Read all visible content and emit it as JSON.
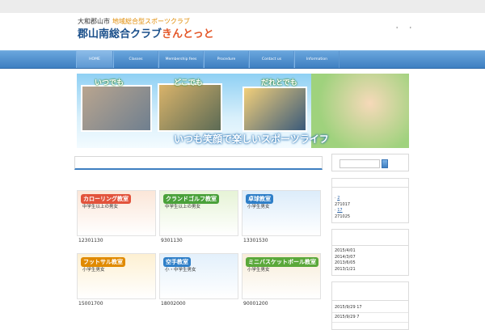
{
  "site": {
    "city": "大和郡山市",
    "tagline": "地域総合型スポーツクラブ",
    "name_main": "郡山南総合クラブ",
    "name_accent": "きんとっと",
    "header_dots": "' '"
  },
  "nav": {
    "items": [
      {
        "label": "HOME",
        "active": true
      },
      {
        "label": "Classes"
      },
      {
        "label": "Membership fees"
      },
      {
        "label": "Procedure"
      },
      {
        "label": "Contact us"
      },
      {
        "label": "Information"
      }
    ]
  },
  "banner": {
    "labels": [
      "いつでも",
      "どこでも",
      "だれとでも"
    ],
    "slogan": "いつも笑顔で楽しいスポーツライフ"
  },
  "classes": [
    {
      "title": "カローリング教室",
      "sub": "中学生以上の男女",
      "num": "12301130",
      "color": "#e2533c",
      "bg": "#fbe6d8"
    },
    {
      "title": "クランドゴルフ教室",
      "sub": "中学生以上の男女",
      "num": "9301130",
      "color": "#4aa13a",
      "bg": "#e6f3d6"
    },
    {
      "title": "卓球教室",
      "sub": "小学生男女",
      "num": "13301530",
      "color": "#2f7fc8",
      "bg": "#dcecfa"
    },
    {
      "title": "フットサル教室",
      "sub": "小学生男女",
      "num": "15001700",
      "color": "#e08a00",
      "bg": "#fdf0d2"
    },
    {
      "title": "空手教室",
      "sub": "小・中学生男女",
      "num": "18002000",
      "color": "#2f7fc8",
      "bg": "#e3f0fb"
    },
    {
      "title": "ミニバスケットボール教室",
      "sub": "小学生男女",
      "num": "90001200",
      "color": "#5aa83a",
      "bg": "#f7ecd8"
    }
  ],
  "sidebar": {
    "search_placeholder": "",
    "widget1": [
      {
        "prefix": "· ",
        "link": "2"
      },
      {
        "prefix": "",
        "text": "271017"
      },
      {
        "prefix": "· ",
        "link": "17"
      },
      {
        "prefix": "",
        "text": "271025"
      }
    ],
    "widget2": [
      "2015/4/01",
      "2014/3/07",
      "2013/6/05",
      "2013/1/21"
    ],
    "widget3": [
      "2015/9/29  17",
      "2015/9/29  7"
    ]
  },
  "colors": {
    "nav_blue": "#3e7fc1",
    "accent_orange": "#e4582a",
    "brand_blue": "#1a4f8a"
  }
}
